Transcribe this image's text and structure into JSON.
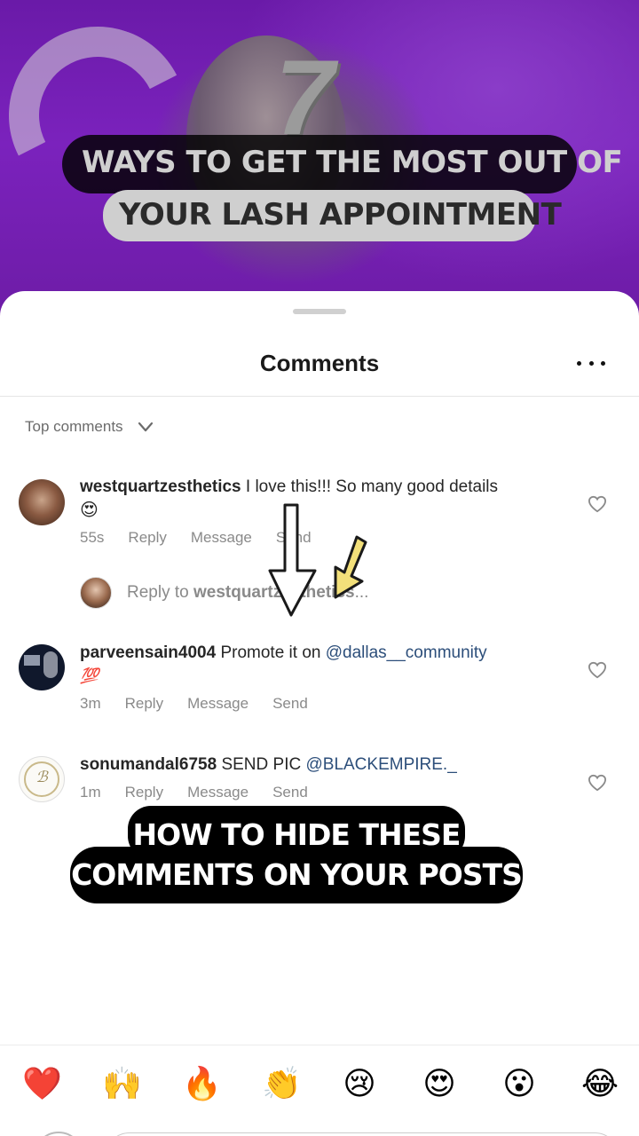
{
  "video": {
    "number": "7",
    "title_line1": "WAYS TO GET THE MOST OUT OF",
    "title_line2": "YOUR LASH APPOINTMENT"
  },
  "sheet": {
    "title": "Comments",
    "more_icon": "more-horizontal-icon",
    "sort_label": "Top comments",
    "sort_icon": "chevron-down-icon"
  },
  "comments": [
    {
      "username": "westquartzesthetics",
      "text": "I love this!!! So many good details",
      "emoji": "😍",
      "time": "55s",
      "reply": "Reply",
      "message": "Message",
      "send": "Send"
    },
    {
      "username": "parveensain4004",
      "text": "Promote it on",
      "mention": "@dallas__community",
      "emoji": "💯",
      "time": "3m",
      "reply": "Reply",
      "message": "Message",
      "send": "Send"
    },
    {
      "username": "sonumandal6758",
      "text": "SEND PIC",
      "mention": "@BLACKEMPIRE._",
      "time": "1m",
      "reply": "Reply",
      "message": "Message",
      "send": "Send"
    }
  ],
  "reply_field": {
    "prefix": "Reply to",
    "target": "westquartzesthetics",
    "suffix": "..."
  },
  "caption": {
    "line1": "HOW TO HIDE THESE",
    "line2": "COMMENTS ON YOUR POSTS"
  },
  "emoji_bar": [
    "❤️",
    "🙌",
    "🔥",
    "👏",
    "😢",
    "😍",
    "😮",
    "😂"
  ],
  "colors": {
    "mention": "#2c4e7a",
    "background_purple": "#7b22bd",
    "arrow_yellow": "#f3e07a"
  }
}
